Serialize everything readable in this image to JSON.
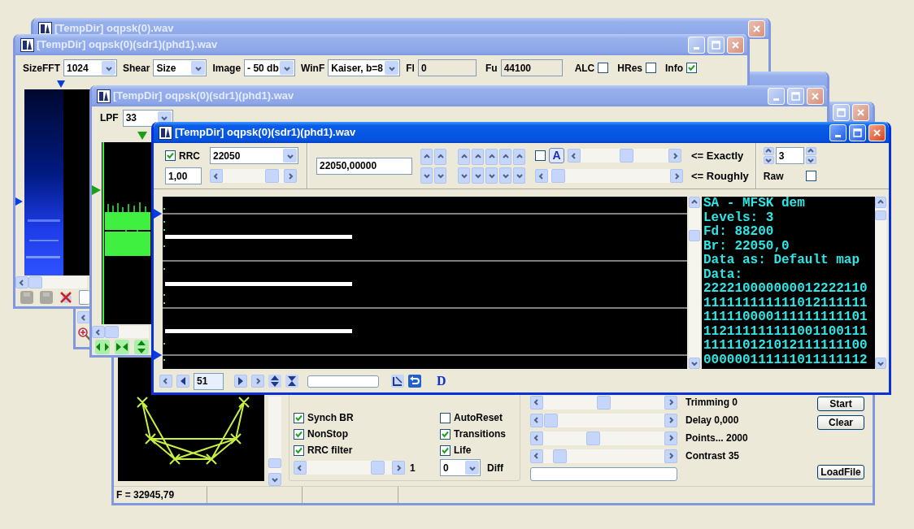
{
  "windows": [
    {
      "kind": "back",
      "title": "[TempDir] oqpsk(0).wav",
      "active": false
    },
    {
      "kind": "main",
      "options": [
        {
          "label": "Synch BR",
          "checked": true
        },
        {
          "label": "AutoReset",
          "checked": false
        },
        {
          "label": "NonStop",
          "checked": true
        },
        {
          "label": "Transitions",
          "checked": true
        },
        {
          "label": "RRC filter",
          "checked": true
        },
        {
          "label": "Life",
          "checked": true
        }
      ],
      "scroll": {
        "level": 0.9,
        "reading": "1"
      },
      "diff": {
        "value": "0",
        "label": "Diff"
      },
      "sliders": [
        {
          "label": "Trimming 0",
          "level": 0.5
        },
        {
          "label": "Delay  0,000",
          "level": 0.01
        },
        {
          "label": "Points... 2000",
          "level": 0.4
        },
        {
          "label": "Contrast 35",
          "level": 0.09
        }
      ],
      "buttons": [
        "Start",
        "Clear",
        "LoadFile"
      ],
      "status": "F = 32945,79"
    },
    {
      "kind": "zoom"
    },
    {
      "kind": "spectrum",
      "title": "[TempDir] oqpsk(0)(sdr1)(phd1).wav",
      "active": false,
      "toolbar": [
        {
          "kind": "combo",
          "label": "SizeFFT",
          "value": "1024"
        },
        {
          "kind": "combo",
          "label": "Shear",
          "value": "Size"
        },
        {
          "kind": "combo",
          "label": "Image",
          "value": "- 50 db"
        },
        {
          "kind": "combo",
          "label": "WinF",
          "value": "Kaiser, b=8"
        },
        {
          "kind": "field",
          "label": "Fl",
          "value": "0"
        },
        {
          "kind": "field",
          "label": "Fu",
          "value": "44100"
        },
        {
          "kind": "check",
          "label": "ALC",
          "checked": false
        },
        {
          "kind": "check",
          "label": "HRes",
          "checked": false
        },
        {
          "kind": "check",
          "label": "Info",
          "checked": true
        }
      ]
    },
    {
      "kind": "filter",
      "title": "[TempDir] oqpsk(0)(sdr1)(phd1).wav",
      "active": false,
      "lpf": {
        "label": "LPF",
        "value": "33"
      }
    },
    {
      "kind": "demod",
      "title": "[TempDir] oqpsk(0)(sdr1)(phd1).wav",
      "active": true,
      "rrc": {
        "label": "RRC",
        "checked": true
      },
      "rate": "22050",
      "rate_slider": {
        "level": 0.9
      },
      "gain": "1,00",
      "frequency": "22050,00000",
      "bold_check": {
        "checked": false
      },
      "bold_button": "A",
      "exact": {
        "label": "<= Exactly",
        "level": 0.53
      },
      "rough": {
        "label": "<= Roughly",
        "level": 0.03
      },
      "levels": "3",
      "raw": {
        "label": "Raw",
        "checked": false
      },
      "output": [
        "SA - MFSK dem",
        "Levels: 3",
        "Fd: 88200",
        "Br: 22050,0",
        "Data as: Default map",
        "Data:",
        "222210000000012222110",
        "111111111111012111111",
        "111110000111111111101",
        "112111111111001100111",
        "111110121012111111100",
        "000000111111011111112"
      ],
      "frame": "51",
      "d_button": "D"
    }
  ]
}
